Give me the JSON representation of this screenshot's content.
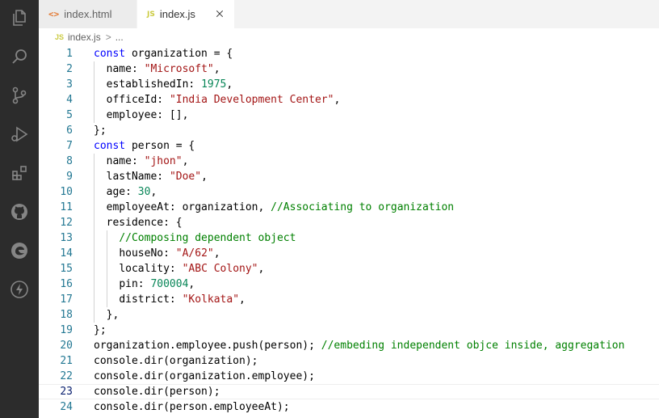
{
  "tabs": [
    {
      "icon": "<>",
      "label": "index.html",
      "active": false
    },
    {
      "icon": "JS",
      "label": "index.js",
      "active": true
    }
  ],
  "breadcrumb": {
    "icon": "JS",
    "file": "index.js",
    "separator": ">",
    "more": "..."
  },
  "editor": {
    "current_line": 23,
    "lines": [
      {
        "n": "1",
        "indent": 0,
        "tokens": [
          [
            "kw",
            "const"
          ],
          [
            "t",
            " organization = {"
          ]
        ]
      },
      {
        "n": "2",
        "indent": 1,
        "tokens": [
          [
            "t",
            "name: "
          ],
          [
            "str",
            "\"Microsoft\""
          ],
          [
            "t",
            ","
          ]
        ]
      },
      {
        "n": "3",
        "indent": 1,
        "tokens": [
          [
            "t",
            "establishedIn: "
          ],
          [
            "num",
            "1975"
          ],
          [
            "t",
            ","
          ]
        ]
      },
      {
        "n": "4",
        "indent": 1,
        "tokens": [
          [
            "t",
            "officeId: "
          ],
          [
            "str",
            "\"India Development Center\""
          ],
          [
            "t",
            ","
          ]
        ]
      },
      {
        "n": "5",
        "indent": 1,
        "tokens": [
          [
            "t",
            "employee: [],"
          ]
        ]
      },
      {
        "n": "6",
        "indent": 0,
        "tokens": [
          [
            "t",
            "};"
          ]
        ]
      },
      {
        "n": "7",
        "indent": 0,
        "tokens": [
          [
            "kw",
            "const"
          ],
          [
            "t",
            " person = {"
          ]
        ]
      },
      {
        "n": "8",
        "indent": 1,
        "tokens": [
          [
            "t",
            "name: "
          ],
          [
            "str",
            "\"jhon\""
          ],
          [
            "t",
            ","
          ]
        ]
      },
      {
        "n": "9",
        "indent": 1,
        "tokens": [
          [
            "t",
            "lastName: "
          ],
          [
            "str",
            "\"Doe\""
          ],
          [
            "t",
            ","
          ]
        ]
      },
      {
        "n": "10",
        "indent": 1,
        "tokens": [
          [
            "t",
            "age: "
          ],
          [
            "num",
            "30"
          ],
          [
            "t",
            ","
          ]
        ]
      },
      {
        "n": "11",
        "indent": 1,
        "tokens": [
          [
            "t",
            "employeeAt: organization, "
          ],
          [
            "cm",
            "//Associating to organization"
          ]
        ]
      },
      {
        "n": "12",
        "indent": 1,
        "tokens": [
          [
            "t",
            "residence: {"
          ]
        ]
      },
      {
        "n": "13",
        "indent": 2,
        "tokens": [
          [
            "cm",
            "//Composing dependent object"
          ]
        ]
      },
      {
        "n": "14",
        "indent": 2,
        "tokens": [
          [
            "t",
            "houseNo: "
          ],
          [
            "str",
            "\"A/62\""
          ],
          [
            "t",
            ","
          ]
        ]
      },
      {
        "n": "15",
        "indent": 2,
        "tokens": [
          [
            "t",
            "locality: "
          ],
          [
            "str",
            "\"ABC Colony\""
          ],
          [
            "t",
            ","
          ]
        ]
      },
      {
        "n": "16",
        "indent": 2,
        "tokens": [
          [
            "t",
            "pin: "
          ],
          [
            "num",
            "700004"
          ],
          [
            "t",
            ","
          ]
        ]
      },
      {
        "n": "17",
        "indent": 2,
        "tokens": [
          [
            "t",
            "district: "
          ],
          [
            "str",
            "\"Kolkata\""
          ],
          [
            "t",
            ","
          ]
        ]
      },
      {
        "n": "18",
        "indent": 1,
        "tokens": [
          [
            "t",
            "},"
          ]
        ]
      },
      {
        "n": "19",
        "indent": 0,
        "tokens": [
          [
            "t",
            "};"
          ]
        ]
      },
      {
        "n": "20",
        "indent": 0,
        "tokens": [
          [
            "t",
            "organization.employee.push(person); "
          ],
          [
            "cm",
            "//embeding independent objce inside, aggregation"
          ]
        ]
      },
      {
        "n": "21",
        "indent": 0,
        "tokens": [
          [
            "t",
            "console.dir(organization);"
          ]
        ]
      },
      {
        "n": "22",
        "indent": 0,
        "tokens": [
          [
            "t",
            "console.dir(organization.employee);"
          ]
        ]
      },
      {
        "n": "23",
        "indent": 0,
        "tokens": [
          [
            "t",
            "console.dir(person);"
          ]
        ]
      },
      {
        "n": "24",
        "indent": 0,
        "tokens": [
          [
            "t",
            "console.dir(person.employeeAt);"
          ]
        ]
      }
    ]
  },
  "activity_bar": [
    "explorer-icon",
    "search-icon",
    "source-control-icon",
    "run-debug-icon",
    "extensions-icon",
    "github-icon",
    "edge-icon",
    "lightning-icon"
  ]
}
